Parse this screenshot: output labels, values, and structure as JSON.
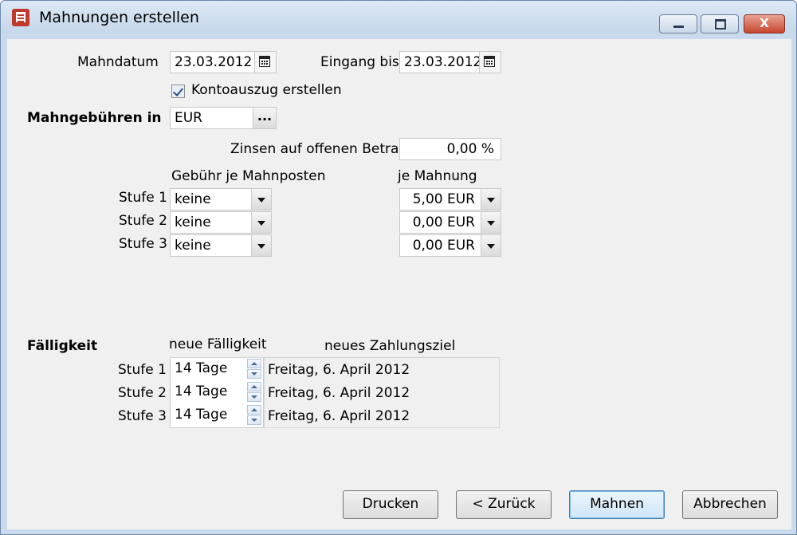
{
  "window": {
    "title": "Mahnungen erstellen",
    "close_symbol": "X",
    "icons": {
      "app": "document-red-icon",
      "min": "minimize-icon",
      "max": "maximize-icon",
      "close": "close-icon"
    }
  },
  "dates": {
    "mahndatum_label": "Mahndatum",
    "mahndatum_value": "23.03.2012",
    "eingang_label": "Eingang bis",
    "eingang_value": "23.03.2012"
  },
  "kontoauszug": {
    "label": "Kontoauszug erstellen",
    "checked": true
  },
  "mahngebuehren": {
    "label": "Mahngebühren in",
    "currency": "EUR",
    "ellipsis": "...",
    "zinsen_label": "Zinsen auf offenen Betrag",
    "zinsen_value": "0,00 %",
    "col_posten": "Gebühr je Mahnposten",
    "col_mahnung": "je Mahnung",
    "rows": [
      {
        "stufe": "Stufe 1",
        "posten": "keine",
        "mahnung": "5,00 EUR"
      },
      {
        "stufe": "Stufe 2",
        "posten": "keine",
        "mahnung": "0,00 EUR"
      },
      {
        "stufe": "Stufe 3",
        "posten": "keine",
        "mahnung": "0,00 EUR"
      }
    ]
  },
  "faelligkeit": {
    "label": "Fälligkeit",
    "col_neu": "neue Fälligkeit",
    "col_ziel": "neues Zahlungsziel",
    "rows": [
      {
        "stufe": "Stufe 1",
        "tage": "14 Tage",
        "ziel": "Freitag, 6. April 2012"
      },
      {
        "stufe": "Stufe 2",
        "tage": "14 Tage",
        "ziel": "Freitag, 6. April 2012"
      },
      {
        "stufe": "Stufe 3",
        "tage": "14 Tage",
        "ziel": "Freitag, 6. April 2012"
      }
    ]
  },
  "buttons": {
    "drucken": "Drucken",
    "zurueck": "< Zurück",
    "mahnen": "Mahnen",
    "abbrechen": "Abbrechen"
  }
}
